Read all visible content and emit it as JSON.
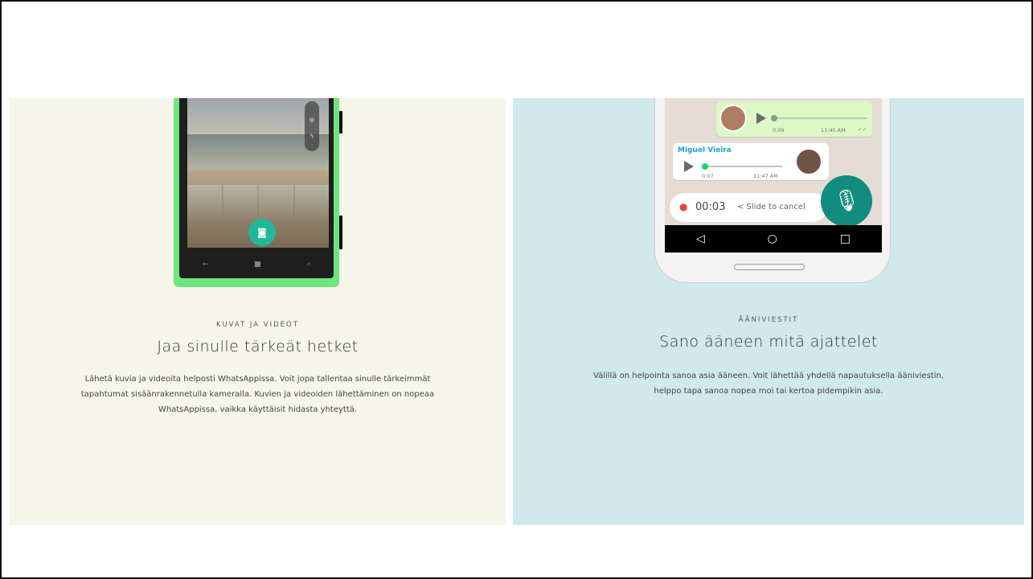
{
  "left": {
    "eyebrow": "KUVAT JA VIDEOT",
    "heading": "Jaa sinulle tärkeät hetket",
    "lines": [
      "Lähetä kuvia ja videoita helposti WhatsAppissa. Voit jopa tallentaa sinulle tärkeimmät",
      "tapahtumat sisäänrakennetulla kameralla. Kuvien ja videoiden lähettäminen on nopeaa",
      "WhatsAppissa, vaikka käyttäisit hidasta yhteyttä."
    ]
  },
  "right": {
    "eyebrow": "ÄÄNIVIESTIT",
    "heading": "Sano ääneen mitä ajattelet",
    "lines": [
      "Välillä on helpointa sanoa asia ääneen. Voit lähettää yhdellä napautuksella ääniviestin,",
      "helppo tapa sanoa nopea moi tai kertoa pidempikin asia."
    ],
    "chat": {
      "out_duration": "0:09",
      "out_time": "11:45 AM",
      "in_sender": "Miguel Vieira",
      "in_duration": "0:07",
      "in_time": "11:47 AM",
      "record_timer": "00:03",
      "slide_cancel": "< Slide to cancel"
    }
  },
  "colors": {
    "left_bg": "#f6f5ea",
    "right_bg": "#d1e9ea",
    "whatsapp_green": "#128c7e",
    "phone_green": "#6ee57c"
  }
}
